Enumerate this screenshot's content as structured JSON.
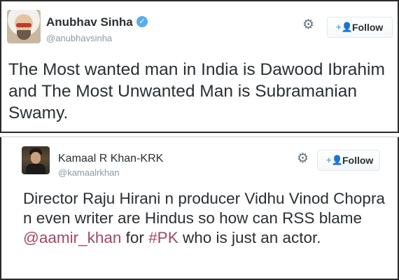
{
  "tweets": [
    {
      "name": "Anubhav Sinha",
      "verified": true,
      "handle": "@anubhavsinha",
      "follow_label": "Follow",
      "text": "The Most wanted man in India is Dawood Ibrahim and The Most Unwanted Man is Subramanian Swamy."
    },
    {
      "name": "Kamaal R Khan-KRK",
      "verified": false,
      "handle": "@kamaalrkhan",
      "follow_label": "Follow",
      "text_parts": {
        "before_mention": "Director Raju Hirani n producer Vidhu Vinod Chopra n even writer are Hindus so how can RSS blame ",
        "mention": "@aamir_khan",
        "between": " for ",
        "hashtag": "#PK",
        "after": " who is just an actor."
      }
    }
  ],
  "icons": {
    "settings": "gear-icon",
    "follow": "add-user-icon",
    "verified": "verified-badge-icon"
  },
  "colors": {
    "link": "#9c4a62",
    "verified": "#55acee",
    "handle": "#8899a6"
  }
}
